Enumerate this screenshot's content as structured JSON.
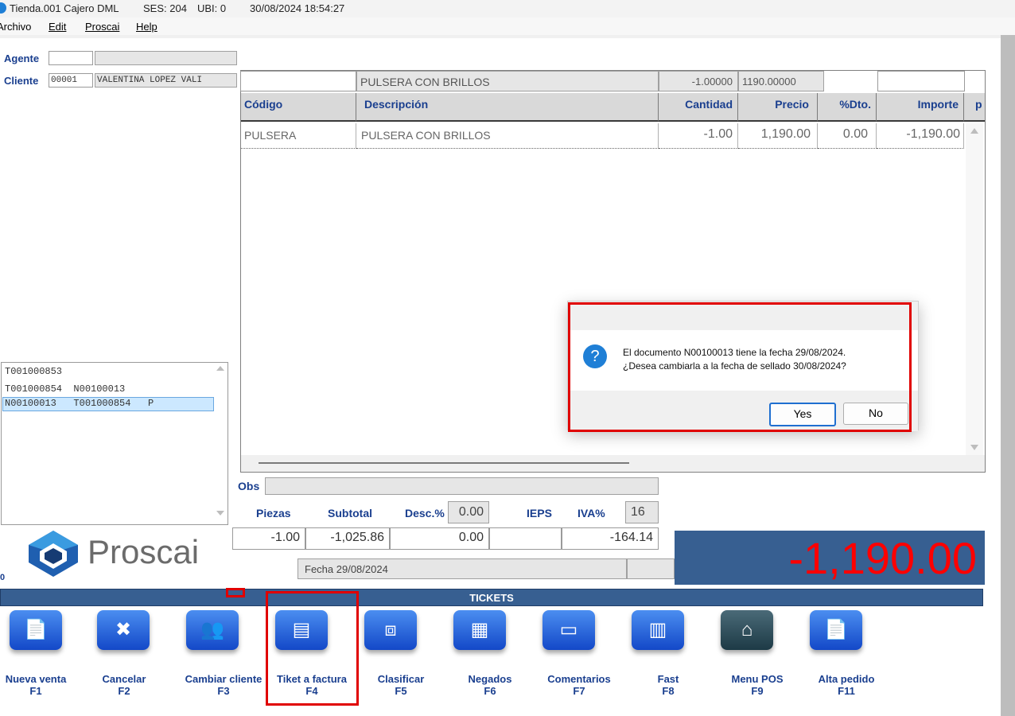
{
  "window": {
    "title": "Tienda.001  Cajero DML",
    "session": "SES: 204",
    "ubi": "UBI: 0",
    "datetime": "30/08/2024 18:54:27"
  },
  "menu": [
    "Archivo",
    "Edit",
    "Proscai",
    "Help"
  ],
  "header": {
    "agente_label": "Agente",
    "cliente_label": "Cliente",
    "cliente_code": "00001",
    "cliente_name": "VALENTINA LOPEZ VALI"
  },
  "entry_row": {
    "descripcion": "PULSERA CON BRILLOS",
    "cantidad": "-1.00000",
    "precio": "1190.00000"
  },
  "grid": {
    "columns": [
      "Código",
      "Descripción",
      "Cantidad",
      "Precio",
      "%Dto.",
      "Importe",
      "p"
    ],
    "rows": [
      {
        "codigo": "PULSERA",
        "descripcion": "PULSERA CON BRILLOS",
        "cantidad": "-1.00",
        "precio": "1,190.00",
        "dto": "0.00",
        "importe": "-1,190.00"
      }
    ]
  },
  "docs_list": [
    "T001000853",
    "T001000854  N00100013",
    "N00100013   T001000854   P"
  ],
  "obs_label": "Obs",
  "totals": {
    "piezas_label": "Piezas",
    "subtotal_label": "Subtotal",
    "desc_label": "Desc.%",
    "desc_value": "0.00",
    "ieps_label": "IEPS",
    "iva_label": "IVA%",
    "iva_rate": "16",
    "piezas": "-1.00",
    "subtotal": "-1,025.86",
    "descuento": "0.00",
    "iva": "-164.14",
    "fecha": "Fecha 29/08/2024",
    "total": "-1,190.00"
  },
  "brand": {
    "name": "Proscai"
  },
  "left_digit": "0",
  "tickets_bar": "TICKETS",
  "buttons": [
    {
      "label": "Nueva venta",
      "key": "F1"
    },
    {
      "label": "Cancelar",
      "key": "F2"
    },
    {
      "label": "Cambiar cliente",
      "key": "F3"
    },
    {
      "label": "Tiket a factura",
      "key": "F4"
    },
    {
      "label": "Clasificar",
      "key": "F5"
    },
    {
      "label": "Negados",
      "key": "F6"
    },
    {
      "label": "Comentarios",
      "key": "F7"
    },
    {
      "label": "Fast",
      "key": "F8"
    },
    {
      "label": "Menu POS",
      "key": "F9"
    },
    {
      "label": "Alta pedido",
      "key": "F11"
    }
  ],
  "dialog": {
    "line1": "El documento N00100013 tiene la fecha 29/08/2024.",
    "line2": "¿Desea cambiarla a la fecha de sellado  30/08/2024?",
    "yes": "Yes",
    "no": "No"
  },
  "colors": {
    "accent_blue": "#375f91",
    "label_blue": "#1a3f8f",
    "total_red": "#ff0000",
    "highlight_red": "#e00000"
  }
}
